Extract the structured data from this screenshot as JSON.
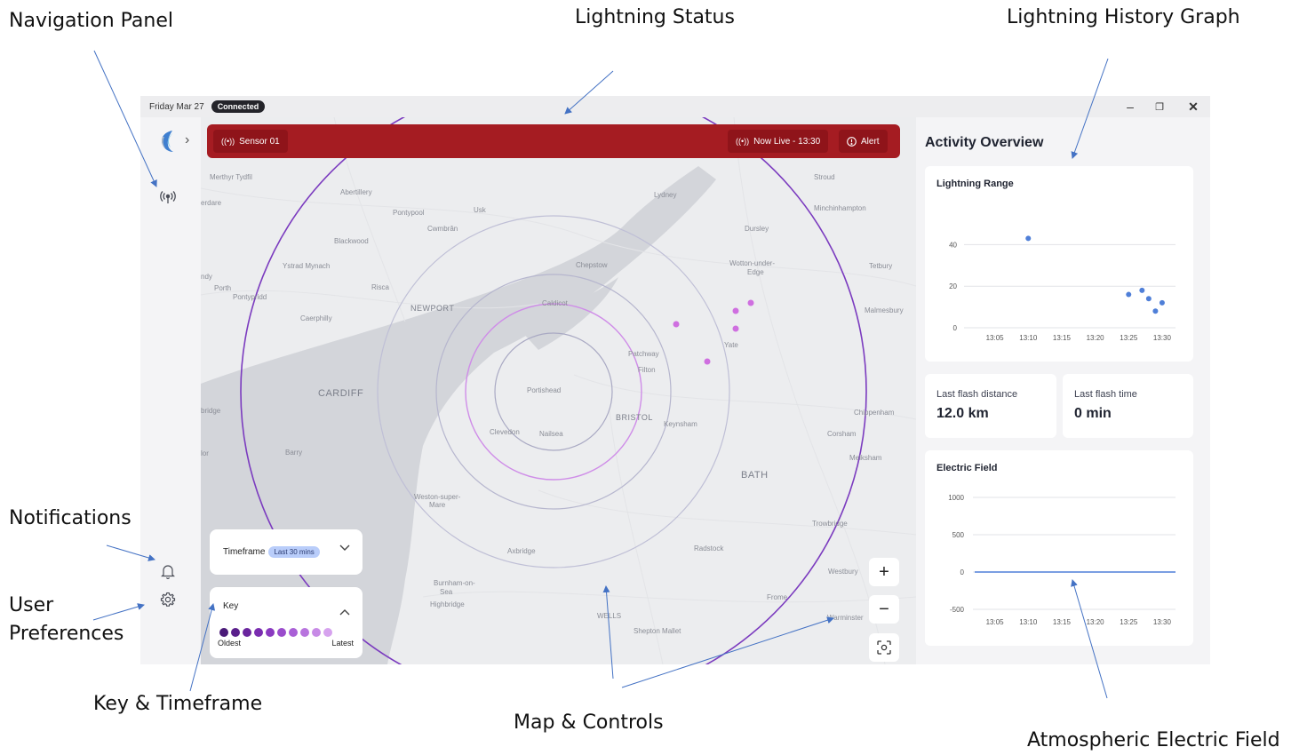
{
  "annotations": {
    "navigation_panel": "Navigation Panel",
    "lightning_status": "Lightning Status",
    "lightning_history_graph": "Lightning History Graph",
    "notifications": "Notifications",
    "user_preferences_1": "User",
    "user_preferences_2": "Preferences",
    "key_timeframe": "Key & Timeframe",
    "map_controls": "Map & Controls",
    "atmospheric_electric_field": "Atmospheric Electric Field"
  },
  "titlebar": {
    "date": "Friday Mar 27",
    "status_badge": "Connected",
    "minimize_label": "–",
    "maximize_label": "❐",
    "close_label": "✕"
  },
  "sidebar": {
    "expand_label": "›",
    "icons": [
      "app-logo-icon",
      "antenna-icon",
      "bell-icon",
      "gear-icon"
    ]
  },
  "status_bar": {
    "sensor_label": "Sensor 01",
    "live_label": "Now Live - 13:30",
    "alert_label": "Alert",
    "color": "#a51c22"
  },
  "map": {
    "places": [
      "Merthyr Tydfil",
      "Abertillery",
      "Pontypool",
      "Usk",
      "Lydney",
      "Stroud",
      "Minchinhampton",
      "Blackwood",
      "Cwmbrân",
      "Dursley",
      "Ystrad Mynach",
      "Chepstow",
      "Wotton-under-",
      "Edge",
      "Tetbury",
      "Porth",
      "Risca",
      "Pontypridd",
      "NEWPORT",
      "Caldicot",
      "Malmesbury",
      "Caerphilly",
      "Yate",
      "Patchway",
      "Filton",
      "CARDIFF",
      "Portishead",
      "BRISTOL",
      "Chippenham",
      "Clevedon",
      "Nailsea",
      "Keynsham",
      "Corsham",
      "Barry",
      "BATH",
      "Melksham",
      "Weston-super-",
      "Mare",
      "Trowbridge",
      "Axbridge",
      "Radstock",
      "Westbury",
      "Burnham-on-",
      "Sea",
      "Highbridge",
      "Frome",
      "WELLS",
      "Shepton Mallet",
      "Warminster",
      "erdare",
      "ndy",
      "bridge",
      "lor"
    ],
    "zoom_in_label": "+",
    "zoom_out_label": "−"
  },
  "timeframe": {
    "label": "Timeframe",
    "selected": "Last 30 mins"
  },
  "key": {
    "title": "Key",
    "oldest_label": "Oldest",
    "latest_label": "Latest",
    "colors": [
      "#4a1a78",
      "#5a1f8c",
      "#6a259e",
      "#7a2db0",
      "#8a3ac0",
      "#9a4ccc",
      "#a95fd6",
      "#b874de",
      "#c78ae6",
      "#d6a2ee"
    ]
  },
  "activity": {
    "title": "Activity Overview",
    "lightning_range_title": "Lightning Range",
    "last_flash_distance_label": "Last flash distance",
    "last_flash_distance_value": "12.0 km",
    "last_flash_time_label": "Last flash time",
    "last_flash_time_value": "0 min",
    "electric_field_title": "Electric Field"
  },
  "chart_data": [
    {
      "type": "scatter",
      "title": "Lightning Range",
      "x_ticks": [
        "13:05",
        "13:10",
        "13:15",
        "13:20",
        "13:25",
        "13:30"
      ],
      "y_ticks": [
        0,
        20,
        40
      ],
      "ylim": [
        0,
        50
      ],
      "xlim": [
        "13:02",
        "13:32"
      ],
      "grid": true,
      "points": [
        {
          "x": "13:10",
          "y": 43
        },
        {
          "x": "13:25",
          "y": 16
        },
        {
          "x": "13:27",
          "y": 18
        },
        {
          "x": "13:28",
          "y": 14
        },
        {
          "x": "13:29",
          "y": 8
        },
        {
          "x": "13:30",
          "y": 12
        }
      ],
      "color": "#4f7fd8"
    },
    {
      "type": "line",
      "title": "Electric Field",
      "x_ticks": [
        "13:05",
        "13:10",
        "13:15",
        "13:20",
        "13:25",
        "13:30"
      ],
      "y_ticks": [
        1000,
        500,
        0,
        -500
      ],
      "ylim": [
        -500,
        1000
      ],
      "grid": true,
      "series": [
        {
          "x": [
            "13:02",
            "13:32"
          ],
          "values": [
            0,
            0
          ]
        }
      ],
      "color": "#4f7fd8"
    }
  ]
}
